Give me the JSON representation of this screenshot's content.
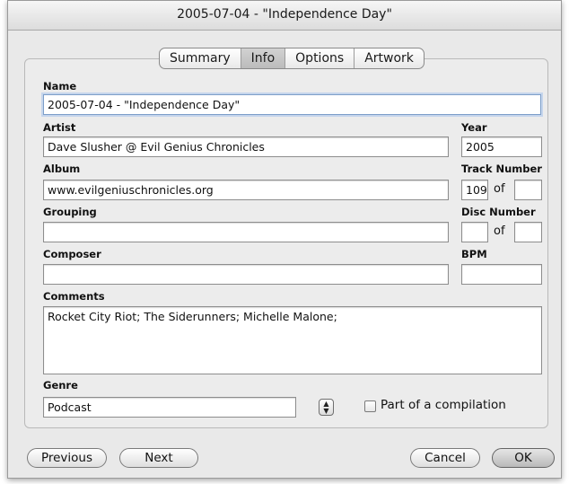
{
  "window": {
    "title": "2005-07-04 - \"Independence Day\""
  },
  "tabs": [
    {
      "label": "Summary",
      "selected": false
    },
    {
      "label": "Info",
      "selected": true
    },
    {
      "label": "Options",
      "selected": false
    },
    {
      "label": "Artwork",
      "selected": false
    }
  ],
  "fields": {
    "name": {
      "label": "Name",
      "value": "2005-07-04 - \"Independence Day\""
    },
    "artist": {
      "label": "Artist",
      "value": "Dave Slusher @ Evil Genius Chronicles"
    },
    "year": {
      "label": "Year",
      "value": "2005"
    },
    "album": {
      "label": "Album",
      "value": "www.evilgeniuschronicles.org"
    },
    "track_number": {
      "label": "Track Number",
      "value": "109",
      "of_label": "of",
      "total": ""
    },
    "grouping": {
      "label": "Grouping",
      "value": ""
    },
    "disc_number": {
      "label": "Disc Number",
      "value": "",
      "of_label": "of",
      "total": ""
    },
    "composer": {
      "label": "Composer",
      "value": ""
    },
    "bpm": {
      "label": "BPM",
      "value": ""
    },
    "comments": {
      "label": "Comments",
      "value": "Rocket City Riot; The Siderunners; Michelle Malone;"
    },
    "genre": {
      "label": "Genre",
      "value": "Podcast"
    },
    "compilation": {
      "label": "Part of a compilation",
      "checked": false
    }
  },
  "buttons": {
    "previous": "Previous",
    "next": "Next",
    "cancel": "Cancel",
    "ok": "OK"
  }
}
